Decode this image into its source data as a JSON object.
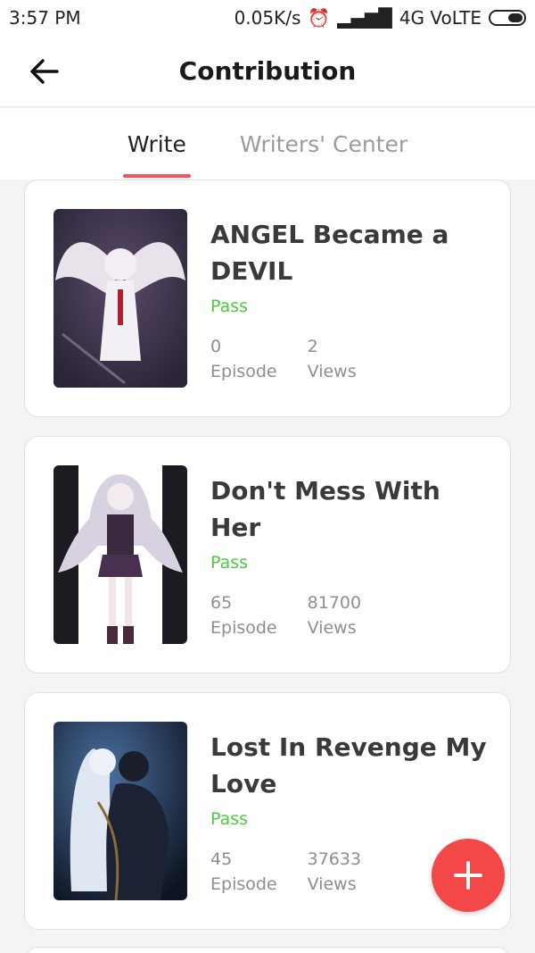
{
  "statusbar": {
    "time": "3:57 PM",
    "speed": "0.05K/s",
    "network": "4G VoLTE"
  },
  "appbar": {
    "title": "Contribution",
    "back_icon": "arrow-left-icon"
  },
  "tabs": [
    {
      "label": "Write",
      "active": true
    },
    {
      "label": "Writers' Center",
      "active": false
    }
  ],
  "books": [
    {
      "title_line1": "ANGEL Became a",
      "title_line2": "DEVIL",
      "status": "Pass",
      "episodes": "0",
      "episodes_label": "Episode",
      "views": "2",
      "views_label": "Views"
    },
    {
      "title_line1": "Don't Mess With Her",
      "title_line2": "",
      "status": "Pass",
      "episodes": "65",
      "episodes_label": "Episode",
      "views": "81700",
      "views_label": "Views"
    },
    {
      "title_line1": "Lost In Revenge My",
      "title_line2": "Love",
      "status": "Pass",
      "episodes": "45",
      "episodes_label": "Episode",
      "views": "37633",
      "views_label": "Views"
    }
  ],
  "fab": {
    "icon": "plus-icon"
  },
  "colors": {
    "accent": "#f25656",
    "status_green": "#4cc93f",
    "fab": "#f44848"
  }
}
